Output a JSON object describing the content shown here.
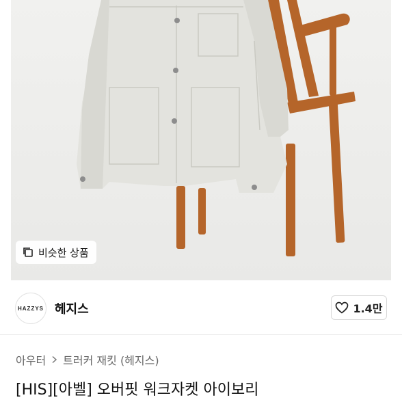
{
  "image": {
    "similar_button_label": "비슷한 상품"
  },
  "shop": {
    "logo_text": "HAZZYS",
    "name": "헤지스",
    "like_count": "1.4만"
  },
  "breadcrumb": {
    "category": "아우터",
    "subcategory": "트러커 재킷 (헤지스)"
  },
  "product": {
    "title": "[HIS][아벨] 오버핏 워크자켓 아이보리"
  },
  "icons": {
    "similar": "copy-icon",
    "like": "heart-outline-icon",
    "breadcrumb_separator": "chevron-right-icon"
  }
}
